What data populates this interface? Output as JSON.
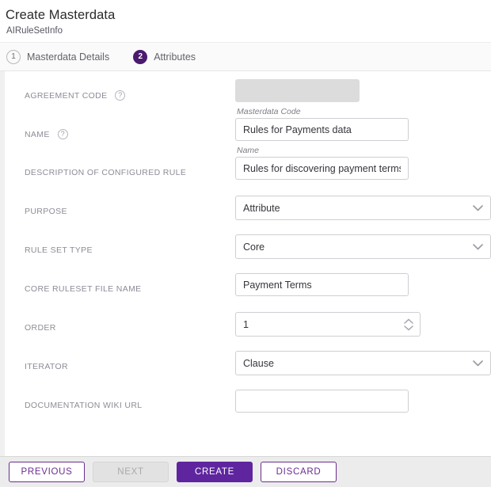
{
  "header": {
    "title": "Create Masterdata",
    "subtitle": "AIRuleSetInfo"
  },
  "stepper": {
    "steps": [
      {
        "number": "1",
        "label": "Masterdata Details",
        "active": false
      },
      {
        "number": "2",
        "label": "Attributes",
        "active": true
      }
    ]
  },
  "form": {
    "fields": [
      {
        "label": "AGREEMENT CODE",
        "help": "?",
        "value": "",
        "hint": "Masterdata Code",
        "type": "text-disabled"
      },
      {
        "label": "NAME",
        "help": "?",
        "value": "Rules for Payments data",
        "hint": "Name",
        "type": "text"
      },
      {
        "label": "DESCRIPTION OF CONFIGURED RULE",
        "value": "Rules for discovering payment terms",
        "type": "text"
      },
      {
        "label": "PURPOSE",
        "value": "Attribute",
        "type": "select"
      },
      {
        "label": "RULE SET TYPE",
        "value": "Core",
        "type": "select"
      },
      {
        "label": "CORE RULESET FILE NAME",
        "value": "Payment Terms",
        "type": "text"
      },
      {
        "label": "ORDER",
        "value": "1",
        "type": "number"
      },
      {
        "label": "ITERATOR",
        "value": "Clause",
        "type": "select"
      },
      {
        "label": "DOCUMENTATION WIKI URL",
        "value": "",
        "type": "text"
      }
    ]
  },
  "footer": {
    "previous_label": "PREVIOUS",
    "next_label": "NEXT",
    "create_label": "CREATE",
    "discard_label": "DISCARD"
  },
  "colors": {
    "primary_purple": "#5f259f",
    "badge_purple": "#4b1a6f",
    "outline_purple": "#6a2d91",
    "disabled_grey": "#dcdcdc",
    "label_grey": "#8c8c97"
  }
}
